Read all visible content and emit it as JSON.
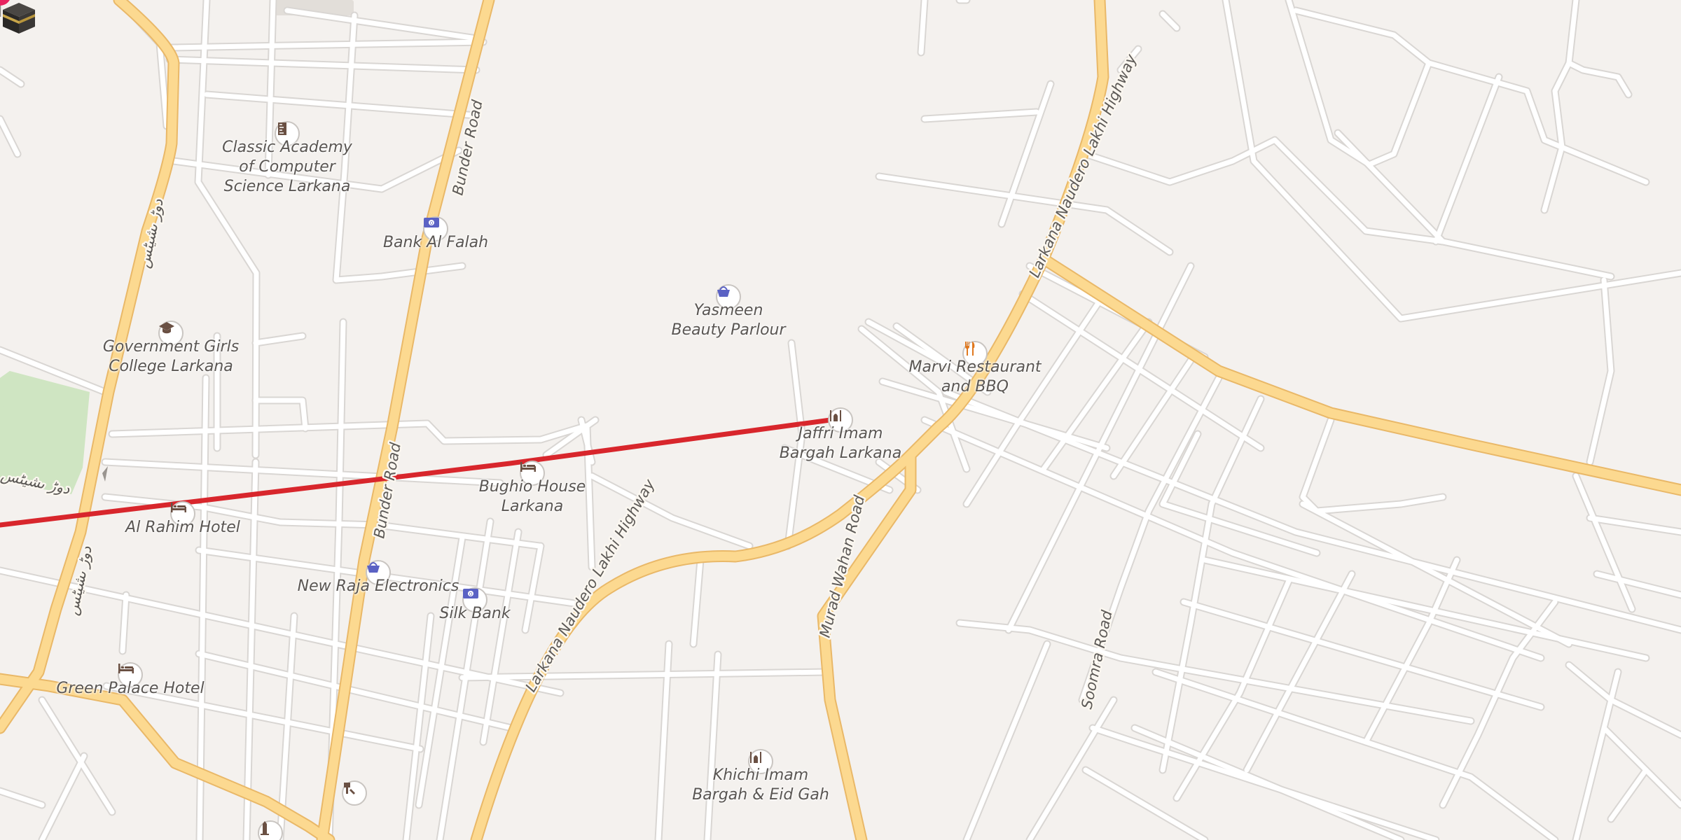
{
  "map": {
    "colors": {
      "background": "#f4f1ee",
      "minor_road": "#ffffff",
      "major_road": "#fcd990",
      "route_line": "#d8262c",
      "park": "#cfe5c2",
      "pin": "#e8245f",
      "poi_blue": "#5b62c4",
      "poi_orange": "#e0781e",
      "poi_brown": "#6a5043"
    },
    "road_labels": [
      {
        "text": "Bunder Road"
      },
      {
        "text": "Bunder Road"
      },
      {
        "text": "Larkana Naudero Lakhi Highway"
      },
      {
        "text": "Larkana Naudero Lakhi Highway"
      },
      {
        "text": "Murad Wahan Road"
      },
      {
        "text": "Soomra Road"
      },
      {
        "text": "دوڑ ںشیٹس"
      },
      {
        "text": "دوڑ ںشیٹس"
      },
      {
        "text": "دوڑ ںشیٹس"
      }
    ],
    "pois": [
      {
        "id": "classic-academy",
        "icon": "school-ruler-icon",
        "lines": [
          "Classic Academy",
          "of Computer",
          "Science Larkana"
        ]
      },
      {
        "id": "bank-al-falah",
        "icon": "bank-note-icon",
        "lines": [
          "Bank Al Falah"
        ]
      },
      {
        "id": "yasmeen-beauty",
        "icon": "shopping-basket-icon",
        "lines": [
          "Yasmeen",
          "Beauty Parlour"
        ]
      },
      {
        "id": "government-girls-college",
        "icon": "graduation-cap-icon",
        "lines": [
          "Government Girls",
          "College Larkana"
        ]
      },
      {
        "id": "marvi-restaurant",
        "icon": "fork-knife-icon",
        "lines": [
          "Marvi Restaurant",
          "and BBQ"
        ]
      },
      {
        "id": "jaffri-imam-bargah",
        "icon": "mosque-icon",
        "lines": [
          "Jaffri Imam",
          "Bargah Larkana"
        ]
      },
      {
        "id": "bughio-house",
        "icon": "bed-icon",
        "lines": [
          "Bughio House",
          "Larkana"
        ]
      },
      {
        "id": "al-rahim-hotel",
        "icon": "bed-icon",
        "lines": [
          "Al Rahim Hotel"
        ]
      },
      {
        "id": "new-raja-electronics",
        "icon": "shopping-basket-icon",
        "lines": [
          "New Raja Electronics"
        ]
      },
      {
        "id": "silk-bank",
        "icon": "bank-note-icon",
        "lines": [
          "Silk Bank"
        ]
      },
      {
        "id": "green-palace-hotel",
        "icon": "bed-icon",
        "lines": [
          "Green Palace Hotel"
        ]
      },
      {
        "id": "khichi-imam-bargah",
        "icon": "mosque-icon",
        "lines": [
          "Khichi Imam",
          "Bargah & Eid Gah"
        ]
      },
      {
        "id": "hardware-shop",
        "icon": "paint-tools-icon",
        "lines": []
      },
      {
        "id": "monument",
        "icon": "monument-icon",
        "lines": []
      }
    ],
    "route": {
      "icon": "kaaba-icon",
      "pin_icon": "map-pin-icon"
    }
  }
}
